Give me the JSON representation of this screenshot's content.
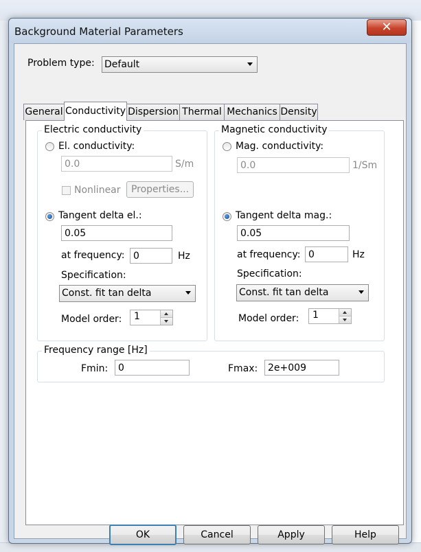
{
  "dialog": {
    "title": "Background Material Parameters",
    "close_symbol": "✕"
  },
  "problem_type": {
    "label": "Problem type:",
    "value": "Default"
  },
  "tabs": [
    {
      "label": "General"
    },
    {
      "label": "Conductivity"
    },
    {
      "label": "Dispersion"
    },
    {
      "label": "Thermal"
    },
    {
      "label": "Mechanics"
    },
    {
      "label": "Density"
    }
  ],
  "electric": {
    "group_title": "Electric conductivity",
    "conductivity_label": "El. conductivity:",
    "conductivity_value": "0.0",
    "conductivity_unit": "S/m",
    "nonlinear_label": "Nonlinear",
    "properties_label": "Properties...",
    "tangent_label": "Tangent delta el.:",
    "tangent_value": "0.05",
    "frequency_label": "at frequency:",
    "frequency_value": "0",
    "frequency_unit": "Hz",
    "specification_label": "Specification:",
    "specification_value": "Const. fit tan delta",
    "model_order_label": "Model order:",
    "model_order_value": "1"
  },
  "magnetic": {
    "group_title": "Magnetic conductivity",
    "conductivity_label": "Mag. conductivity:",
    "conductivity_value": "0.0",
    "conductivity_unit": "1/Sm",
    "tangent_label": "Tangent delta mag.:",
    "tangent_value": "0.05",
    "frequency_label": "at frequency:",
    "frequency_value": "0",
    "frequency_unit": "Hz",
    "specification_label": "Specification:",
    "specification_value": "Const. fit tan delta",
    "model_order_label": "Model order:",
    "model_order_value": "1"
  },
  "frequency_range": {
    "group_title": "Frequency range [Hz]",
    "fmin_label": "Fmin:",
    "fmin_value": "0",
    "fmax_label": "Fmax:",
    "fmax_value": "2e+009"
  },
  "buttons": {
    "ok": "OK",
    "cancel": "Cancel",
    "apply": "Apply",
    "help": "Help"
  }
}
